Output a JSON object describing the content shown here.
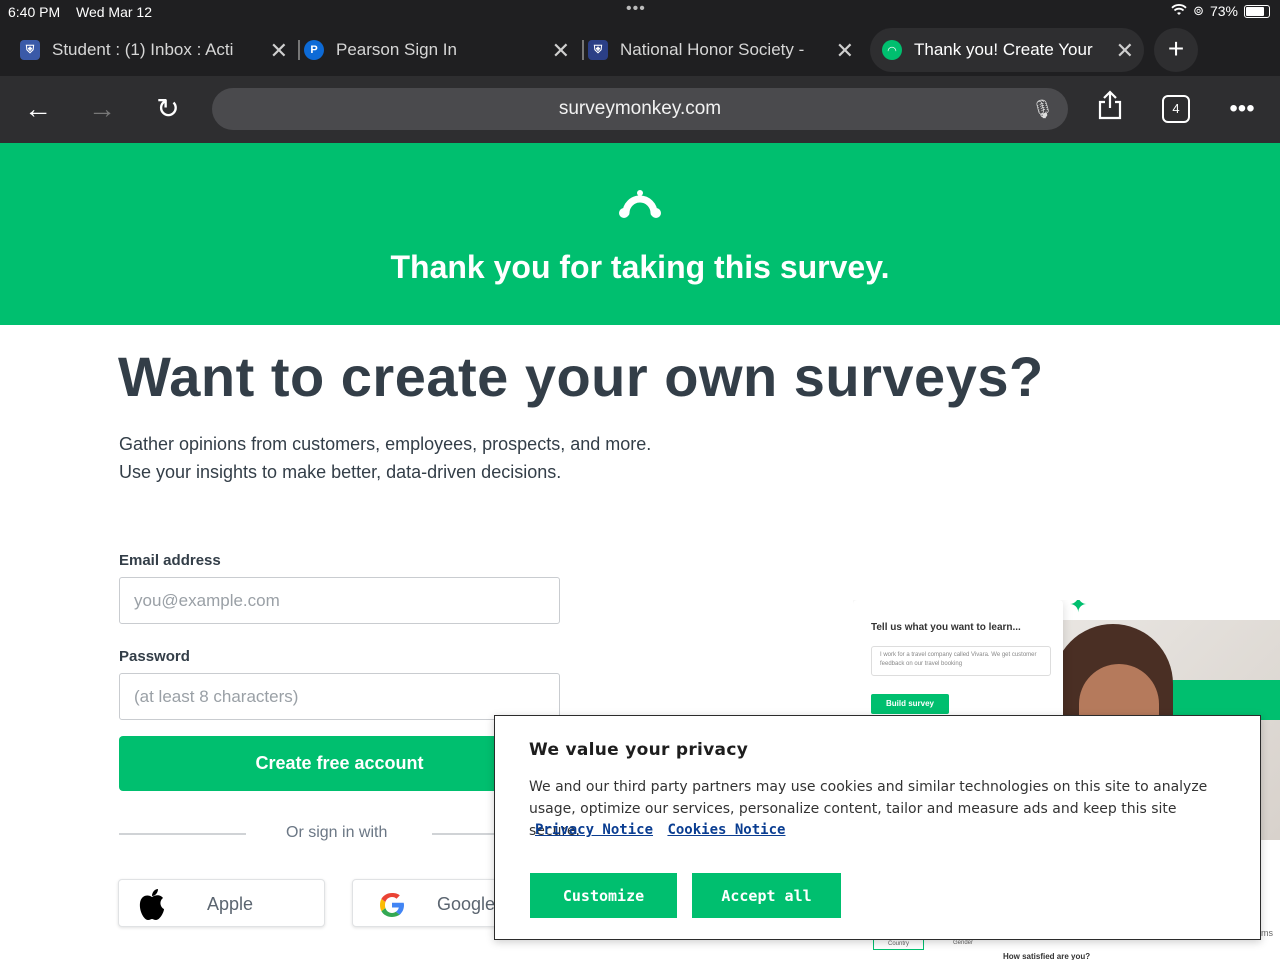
{
  "status_bar": {
    "time": "6:40 PM",
    "date": "Wed Mar 12",
    "dots": "•••",
    "battery": "73%",
    "battery_level": 0.73
  },
  "tabs": [
    {
      "title": "Student : (1) Inbox : Acti",
      "active": false
    },
    {
      "title": "Pearson Sign In",
      "active": false
    },
    {
      "title": "National Honor Society -",
      "active": false
    },
    {
      "title": "Thank you! Create Your",
      "active": true
    }
  ],
  "toolbar": {
    "url": "surveymonkey.com",
    "tab_count": "4"
  },
  "hero": {
    "message": "Thank you for taking this survey.",
    "bg_color": "#00bf6f"
  },
  "main": {
    "headline": "Want to create your own surveys?",
    "subline1": "Gather opinions from customers, employees, prospects, and more.",
    "subline2": "Use your insights to make better, data-driven decisions.",
    "email_label": "Email address",
    "email_placeholder": "you@example.com",
    "password_label": "Password",
    "password_placeholder": "(at least 8 characters)",
    "cta_label": "Create free account",
    "or_text": "Or sign in with",
    "sso_apple": "Apple",
    "sso_google": "Google"
  },
  "preview": {
    "question": "Tell us what you want to learn...",
    "textarea": "I work for a travel company called Vivara. We get customer feedback on our travel booking",
    "button": "Build survey",
    "chip1": "Country",
    "chip2": "Gender",
    "question2": "How satisfied are you?",
    "tail": "ms"
  },
  "cookie": {
    "title": "We value your privacy",
    "body": "We and our third party partners may use cookies and similar technologies on this site to analyze usage, optimize our services, personalize content, tailor and measure ads and keep this site secure.",
    "privacy_link": "Privacy Notice",
    "cookies_link": "Cookies Notice",
    "customize": "Customize",
    "accept": "Accept all"
  }
}
